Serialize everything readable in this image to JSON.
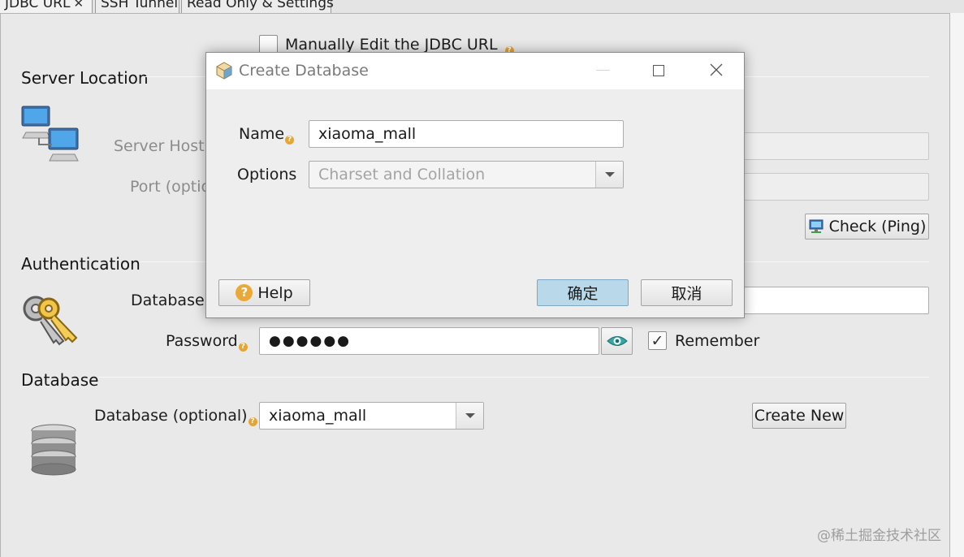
{
  "tabs": [
    {
      "label": "JDBC URL",
      "active": true
    },
    {
      "label": "SSH Tunnel",
      "active": false
    },
    {
      "label": "Read Only & Settings",
      "active": false
    }
  ],
  "jdbc": {
    "manual_edit_label": "Manually Edit the JDBC URL",
    "manual_edit_checked": false
  },
  "server_location": {
    "title": "Server Location",
    "host_label": "Server Host o",
    "port_label": "Port (optio",
    "check_button": "Check (Ping)"
  },
  "authentication": {
    "title": "Authentication",
    "user_label": "Database U",
    "password_label": "Password",
    "password_value": "●●●●●●",
    "remember_label": "Remember",
    "remember_checked": true
  },
  "database": {
    "title": "Database",
    "label": "Database (optional)",
    "value": "xiaoma_mall",
    "create_new": "Create New"
  },
  "dialog": {
    "title": "Create Database",
    "name_label": "Name",
    "name_value": "xiaoma_mall",
    "options_label": "Options",
    "options_placeholder": "Charset and Collation",
    "help_button": "Help",
    "ok_button": "确定",
    "cancel_button": "取消",
    "ok_color": "#b9d8ea"
  },
  "watermark": "@稀土掘金技术社区"
}
